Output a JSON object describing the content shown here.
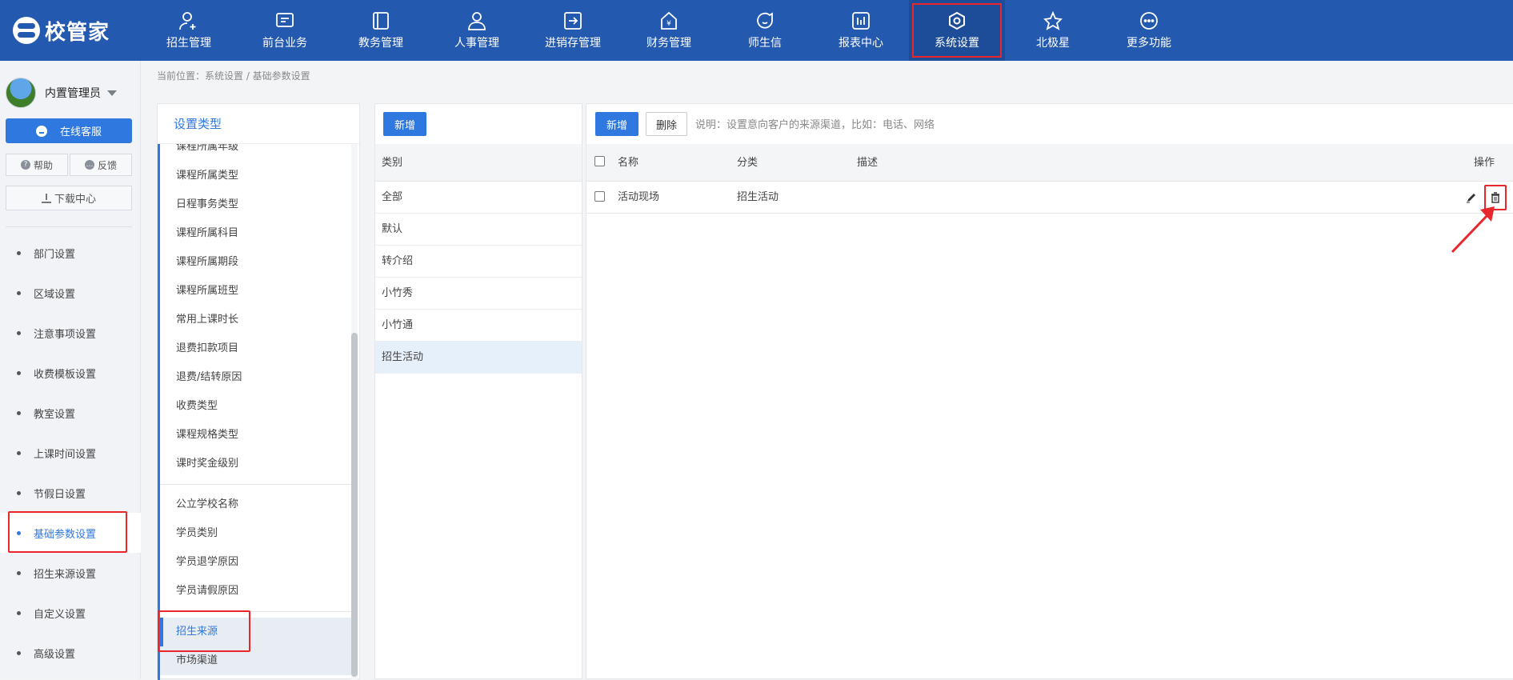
{
  "app": {
    "logo_text": "校管家"
  },
  "topnav": {
    "items": [
      {
        "label": "招生管理",
        "icon": "person-add-icon"
      },
      {
        "label": "前台业务",
        "icon": "desk-icon"
      },
      {
        "label": "教务管理",
        "icon": "book-icon"
      },
      {
        "label": "人事管理",
        "icon": "person-icon"
      },
      {
        "label": "进销存管理",
        "icon": "inventory-icon"
      },
      {
        "label": "财务管理",
        "icon": "finance-icon"
      },
      {
        "label": "师生信",
        "icon": "chat-icon"
      },
      {
        "label": "报表中心",
        "icon": "report-icon"
      },
      {
        "label": "系统设置",
        "icon": "settings-icon",
        "active": true
      },
      {
        "label": "北极星",
        "icon": "star-icon"
      },
      {
        "label": "更多功能",
        "icon": "more-icon"
      }
    ]
  },
  "sidebar": {
    "user_name": "内置管理员",
    "online_service": "在线客服",
    "help": "帮助",
    "feedback": "反馈",
    "download_center": "下载中心",
    "menu": [
      {
        "label": "部门设置"
      },
      {
        "label": "区域设置"
      },
      {
        "label": "注意事项设置"
      },
      {
        "label": "收费模板设置"
      },
      {
        "label": "教室设置"
      },
      {
        "label": "上课时间设置"
      },
      {
        "label": "节假日设置"
      },
      {
        "label": "基础参数设置",
        "active": true
      },
      {
        "label": "招生来源设置"
      },
      {
        "label": "自定义设置"
      },
      {
        "label": "高级设置"
      }
    ]
  },
  "breadcrumb": "当前位置：系统设置 / 基础参数设置",
  "types_panel": {
    "title": "设置类型",
    "group1": [
      "课程所属年级",
      "课程所属类型",
      "日程事务类型",
      "课程所属科目",
      "课程所属期段",
      "课程所属班型",
      "常用上课时长",
      "退费扣款项目",
      "退费/结转原因",
      "收费类型",
      "课程规格类型",
      "课时奖金级别"
    ],
    "group2": [
      "公立学校名称",
      "学员类别",
      "学员退学原因",
      "学员请假原因"
    ],
    "group3": [
      "招生来源",
      "市场渠道"
    ],
    "active": "招生来源"
  },
  "category_panel": {
    "add_label": "新增",
    "header": "类别",
    "items": [
      "全部",
      "默认",
      "转介绍",
      "小竹秀",
      "小竹通",
      "招生活动"
    ],
    "active": "招生活动"
  },
  "main_panel": {
    "add_label": "新增",
    "delete_label": "删除",
    "hint": "说明：设置意向客户的来源渠道，比如：电话、网络",
    "columns": {
      "name": "名称",
      "category": "分类",
      "desc": "描述",
      "action": "操作"
    },
    "rows": [
      {
        "name": "活动现场",
        "category": "招生活动",
        "desc": ""
      }
    ]
  },
  "colors": {
    "nav_bg": "#2459b0",
    "accent": "#2f78e0",
    "highlight": "#e8262b"
  }
}
